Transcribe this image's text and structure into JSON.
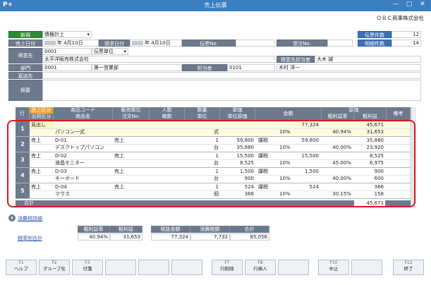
{
  "window": {
    "app_icon": "P+",
    "title": "売上伝票",
    "minimize": "—",
    "maximize": "▢",
    "close": "✕"
  },
  "company": "ＯＢＣ商事株式会社",
  "header": {
    "new_badge": "新規",
    "type_value": "債権計上",
    "sales_date_label": "売上日付",
    "sales_date_value": "年  4月10日",
    "invoice_date_label": "請求日付",
    "invoice_date_value": "年  4月10日",
    "slip_no_label": "伝票No.",
    "order_no_label": "受注No.",
    "slip_count_label": "伝票件数",
    "slip_count_value": "12",
    "detail_count_label": "明細件数",
    "detail_count_value": "14",
    "customer_label": "得意先",
    "customer_code": "0001",
    "slip_unit": "伝票単位",
    "customer_name": "太平洋販売株式会社",
    "customer_staff_label": "得意先担当者",
    "customer_staff_value": "大木 誠",
    "dept_label": "部門",
    "dept_code": "0001",
    "dept_name": "第一営業部",
    "staff_label": "担当者",
    "staff_code": "0101",
    "staff_name": "木村 洋一",
    "ship_label": "直送先",
    "memo_label": "摘要"
  },
  "grid": {
    "headers_top": [
      "行",
      "売上区分",
      "商品コード",
      "販売単位",
      "入数",
      "数量",
      "単価",
      "金額",
      "原価",
      "備考"
    ],
    "headers_bottom": [
      "出荷区分",
      "商品名",
      "注文No.",
      "箱数",
      "単位",
      "単位原価",
      "粗利益率",
      "粗利益"
    ],
    "rows": [
      {
        "no": "1",
        "kubun": "見出し",
        "code": "",
        "unit": "",
        "qty": "",
        "price": "",
        "tax": "",
        "amount": "77,324",
        "cost": "45,671",
        "name": "パソコン一式",
        "unit2": "式",
        "unitcost": "",
        "rate": "10%",
        "gpr": "40.94%",
        "gp": "31,653"
      },
      {
        "no": "2",
        "kubun": "売上",
        "code": "D-01",
        "unit": "売上",
        "qty": "1",
        "price": "59,800",
        "tax": "課税",
        "amount": "59,800",
        "cost": "35,880",
        "name": "デスクトップパソコン",
        "unit2": "台",
        "unitcost": "35,880",
        "rate": "10%",
        "gpr": "40.00%",
        "gp": "23,920"
      },
      {
        "no": "3",
        "kubun": "売上",
        "code": "D-02",
        "unit": "売上",
        "qty": "1",
        "price": "15,500",
        "tax": "課税",
        "amount": "15,500",
        "cost": "8,525",
        "name": "液晶モニター",
        "unit2": "台",
        "unitcost": "8,525",
        "rate": "10%",
        "gpr": "45.00%",
        "gp": "6,975"
      },
      {
        "no": "4",
        "kubun": "売上",
        "code": "D-03",
        "unit": "売上",
        "qty": "1",
        "price": "1,500",
        "tax": "課税",
        "amount": "1,500",
        "cost": "900",
        "name": "キーボード",
        "unit2": "台",
        "unitcost": "900",
        "rate": "10%",
        "gpr": "40.00%",
        "gp": "600"
      },
      {
        "no": "5",
        "kubun": "売上",
        "code": "D-04",
        "unit": "売上",
        "qty": "1",
        "price": "524",
        "tax": "課税",
        "amount": "524",
        "cost": "366",
        "name": "マウス",
        "unit2": "個",
        "unitcost": "366",
        "rate": "10%",
        "gpr": "30.15%",
        "gp": "158"
      }
    ],
    "total_label": "合計",
    "total_cost": "45,671"
  },
  "tax_detail_link": "消費税詳細",
  "tax_rate_total_link": "税率別合計",
  "summary1": {
    "headers": [
      "粗利益率",
      "粗利益"
    ],
    "values": [
      "40.94%",
      "31,653"
    ]
  },
  "summary2": {
    "headers": [
      "税抜金額",
      "消費税額",
      "合計"
    ],
    "values": [
      "77,324",
      "7,732",
      "85,056"
    ]
  },
  "fkeys": [
    {
      "key": "F1",
      "label": "ヘルプ"
    },
    {
      "key": "F2",
      "label": "グループ化"
    },
    {
      "key": "F3",
      "label": "付箋"
    },
    {
      "key": "",
      "label": ""
    },
    {
      "key": "",
      "label": ""
    },
    {
      "key": "",
      "label": ""
    },
    {
      "key": "F7",
      "label": "行削除"
    },
    {
      "key": "F8",
      "label": "行挿入"
    },
    {
      "key": "",
      "label": ""
    },
    {
      "key": "F10",
      "label": "中止"
    },
    {
      "key": "",
      "label": ""
    },
    {
      "key": "F12",
      "label": "終了"
    }
  ]
}
